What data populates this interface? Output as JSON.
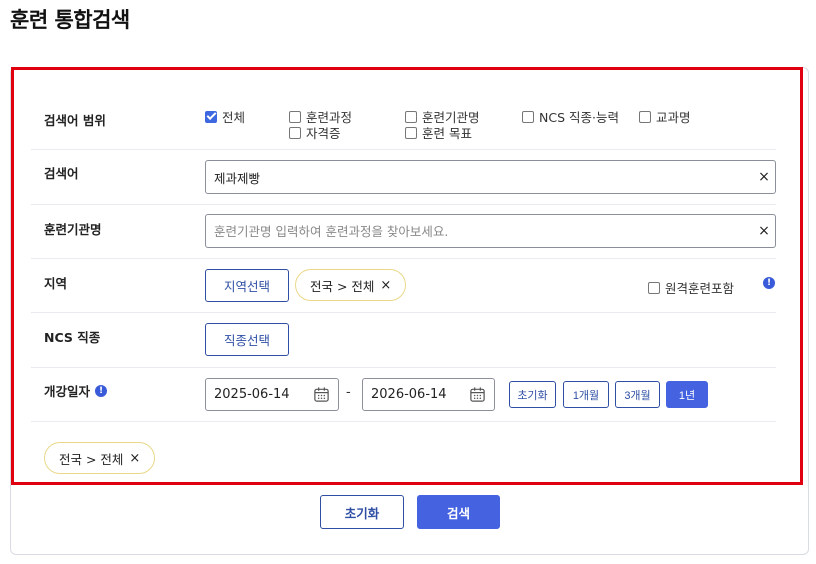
{
  "page": {
    "title": "훈련 통합검색"
  },
  "scope": {
    "label": "검색어 범위",
    "options": [
      {
        "label": "전체",
        "checked": true
      },
      {
        "label": "훈련과정",
        "checked": false
      },
      {
        "label": "훈련기관명",
        "checked": false
      },
      {
        "label": "NCS 직종·능력",
        "checked": false
      },
      {
        "label": "교과명",
        "checked": false
      },
      {
        "label": "자격증",
        "checked": false
      },
      {
        "label": "훈련 목표",
        "checked": false
      }
    ]
  },
  "keyword": {
    "label": "검색어",
    "value": "제과제빵",
    "clear": "×"
  },
  "institution": {
    "label": "훈련기관명",
    "value": "",
    "placeholder": "훈련기관명 입력하여 훈련과정을 찾아보세요.",
    "clear": "×"
  },
  "region": {
    "label": "지역",
    "select_button": "지역선택",
    "chip": "전국 > 전체",
    "chip_remove": "×",
    "remote_label": "원격훈련포함",
    "remote_checked": false,
    "info_icon": "!"
  },
  "ncs": {
    "label": "NCS 직종",
    "select_button": "직종선택"
  },
  "start_date": {
    "label": "개강일자",
    "info_icon": "!",
    "from": "2025-06-14",
    "separator": "-",
    "to": "2026-06-14",
    "presets": [
      {
        "label": "초기화",
        "active": false
      },
      {
        "label": "1개월",
        "active": false
      },
      {
        "label": "3개월",
        "active": false
      },
      {
        "label": "1년",
        "active": true
      }
    ]
  },
  "summary_chip": {
    "label": "전국 > 전체",
    "remove": "×"
  },
  "actions": {
    "reset": "초기화",
    "search": "검색"
  },
  "colors": {
    "accent": "#4562e0",
    "outline": "#2f4fa5",
    "highlight": "#e0000f",
    "chip_border": "#e9d88a"
  }
}
